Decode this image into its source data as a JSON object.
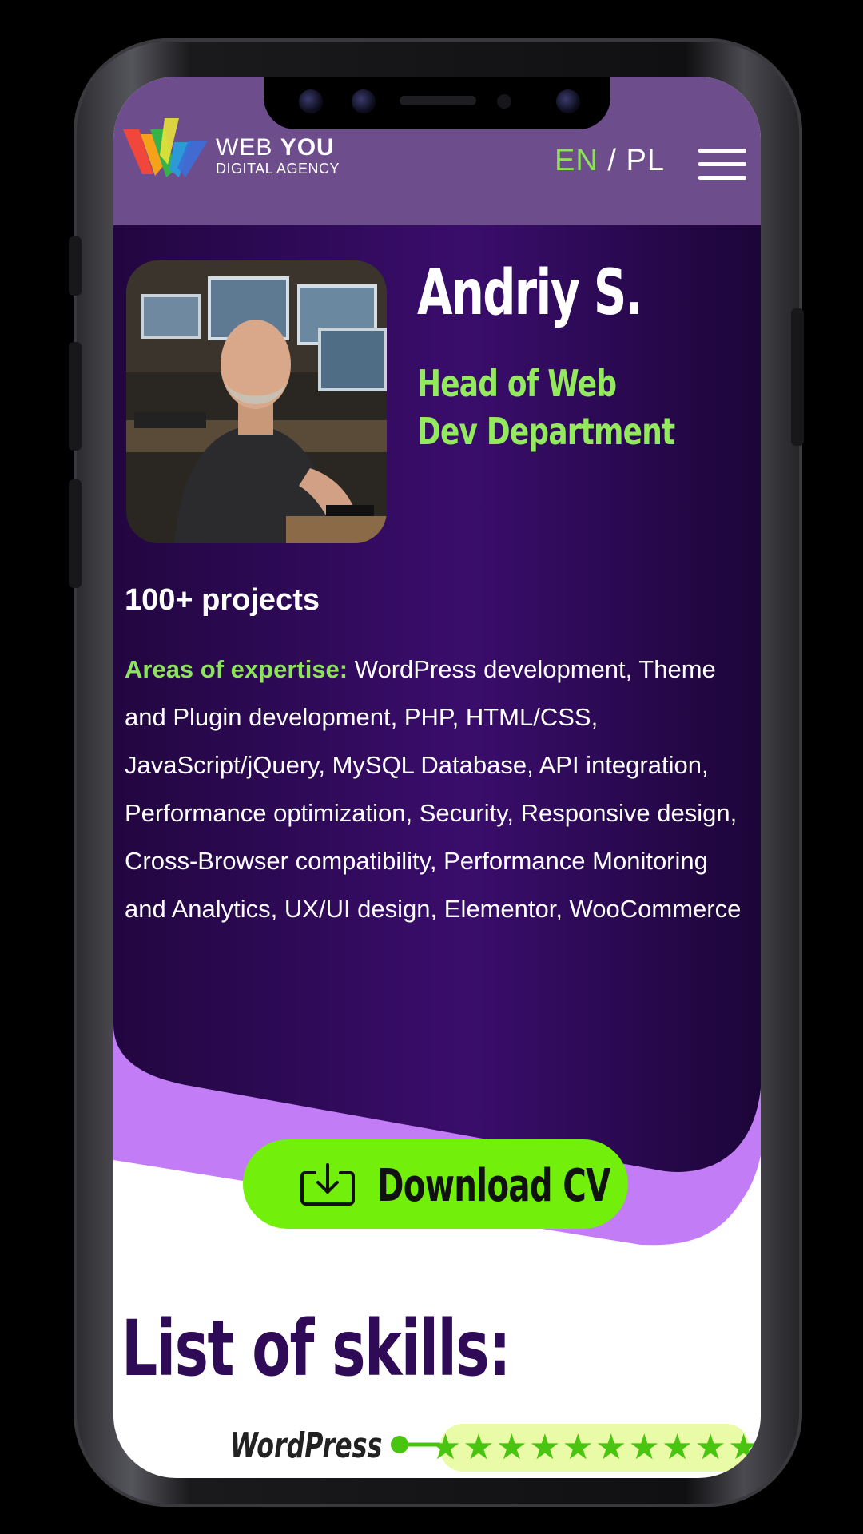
{
  "brand": {
    "name_light": "WEB",
    "name_bold": "YOU",
    "tagline": "DIGITAL AGENCY"
  },
  "language": {
    "active": "EN",
    "separator": "/",
    "other": "PL"
  },
  "icons": {
    "logo": "webyou-logo-icon",
    "menu": "hamburger-menu-icon",
    "download": "download-icon",
    "star": "star-icon",
    "link": "connector-dot-icon"
  },
  "profile": {
    "name": "Andriy S.",
    "role": "Head of Web Dev Department",
    "projects": "100+ projects",
    "expertise_label": "Areas of expertise:",
    "expertise_text": "WordPress development, Theme and Plugin development, PHP, HTML/CSS, JavaScript/jQuery, MySQL Database, API integration, Performance optimization, Security, Responsive design, Cross-Browser compatibility, Performance Monitoring and Analytics, UX/UI design, Elementor, WooCommerce"
  },
  "cta": {
    "download_label": "Download CV"
  },
  "skills": {
    "title": "List of skills:",
    "items": [
      {
        "name": "WordPress",
        "rating": 10,
        "max": 10
      }
    ]
  },
  "colors": {
    "header_bg": "#6e4d8c",
    "hero_bg": "#2c0a52",
    "accent_green": "#72ef0a",
    "text_green": "#93ea5c",
    "wave_purple": "#c07af5",
    "title_purple": "#2f0a56"
  }
}
